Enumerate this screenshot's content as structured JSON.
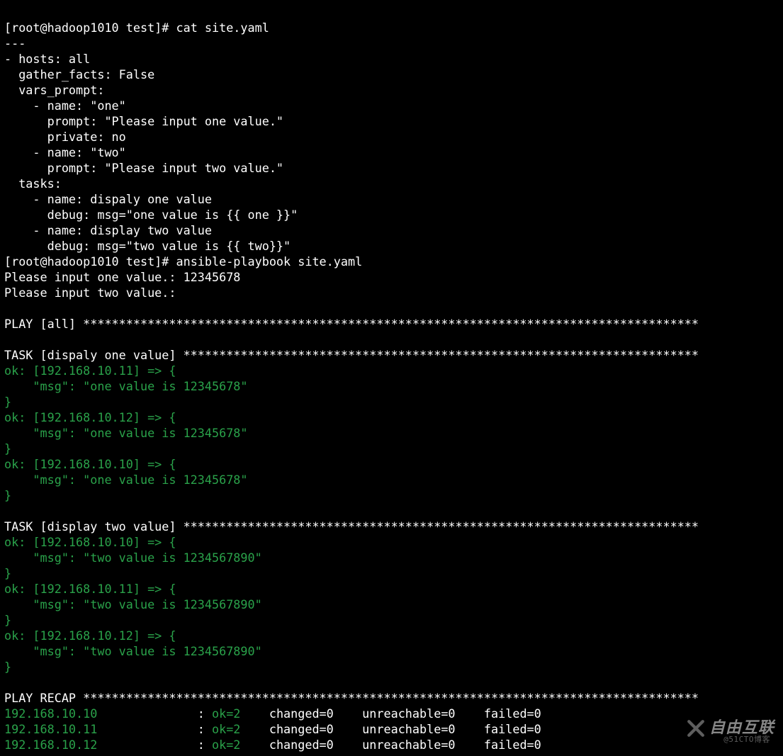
{
  "colors": {
    "bg": "#000000",
    "fg": "#ffffff",
    "ok": "#2aa24a"
  },
  "prompt1": {
    "user_host": "[root@hadoop1010 test]# ",
    "cmd": "cat site.yaml"
  },
  "yaml": {
    "l1": "---",
    "l2": "- hosts: all",
    "l3": "  gather_facts: False",
    "l4": "  vars_prompt:",
    "l5": "    - name: \"one\"",
    "l6": "      prompt: \"Please input one value.\"",
    "l7": "      private: no",
    "l8": "    - name: \"two\"",
    "l9": "      prompt: \"Please input two value.\"",
    "l10": "  tasks:",
    "l11": "    - name: dispaly one value",
    "l12": "      debug: msg=\"one value is {{ one }}\"",
    "l13": "    - name: display two value",
    "l14": "      debug: msg=\"two value is {{ two}}\""
  },
  "prompt2": {
    "user_host": "[root@hadoop1010 test]# ",
    "cmd": "ansible-playbook site.yaml"
  },
  "input1": "Please input one value.: 12345678",
  "input2": "Please input two value.: ",
  "blank": "",
  "play_all": "PLAY [all] **************************************************************************************",
  "task1_hdr": "TASK [dispaly one value] ************************************************************************",
  "t1": {
    "h1a": "ok: [192.168.10.11] => {",
    "h1b": "    \"msg\": \"one value is 12345678\"",
    "h1c": "}",
    "h2a": "ok: [192.168.10.12] => {",
    "h2b": "    \"msg\": \"one value is 12345678\"",
    "h2c": "}",
    "h3a": "ok: [192.168.10.10] => {",
    "h3b": "    \"msg\": \"one value is 12345678\"",
    "h3c": "}"
  },
  "task2_hdr": "TASK [display two value] ************************************************************************",
  "t2": {
    "h1a": "ok: [192.168.10.10] => {",
    "h1b": "    \"msg\": \"two value is 1234567890\"",
    "h1c": "}",
    "h2a": "ok: [192.168.10.11] => {",
    "h2b": "    \"msg\": \"two value is 1234567890\"",
    "h2c": "}",
    "h3a": "ok: [192.168.10.12] => {",
    "h3b": "    \"msg\": \"two value is 1234567890\"",
    "h3c": "}"
  },
  "recap_hdr": "PLAY RECAP **************************************************************************************",
  "recap": [
    {
      "host": "192.168.10.10             ",
      "colon": " : ",
      "ok": "ok=2   ",
      "rest": " changed=0    unreachable=0    failed=0   "
    },
    {
      "host": "192.168.10.11             ",
      "colon": " : ",
      "ok": "ok=2   ",
      "rest": " changed=0    unreachable=0    failed=0   "
    },
    {
      "host": "192.168.10.12             ",
      "colon": " : ",
      "ok": "ok=2   ",
      "rest": " changed=0    unreachable=0    failed=0   "
    }
  ],
  "watermark": {
    "text": "自由互联",
    "sub": "@51CTO博客"
  }
}
